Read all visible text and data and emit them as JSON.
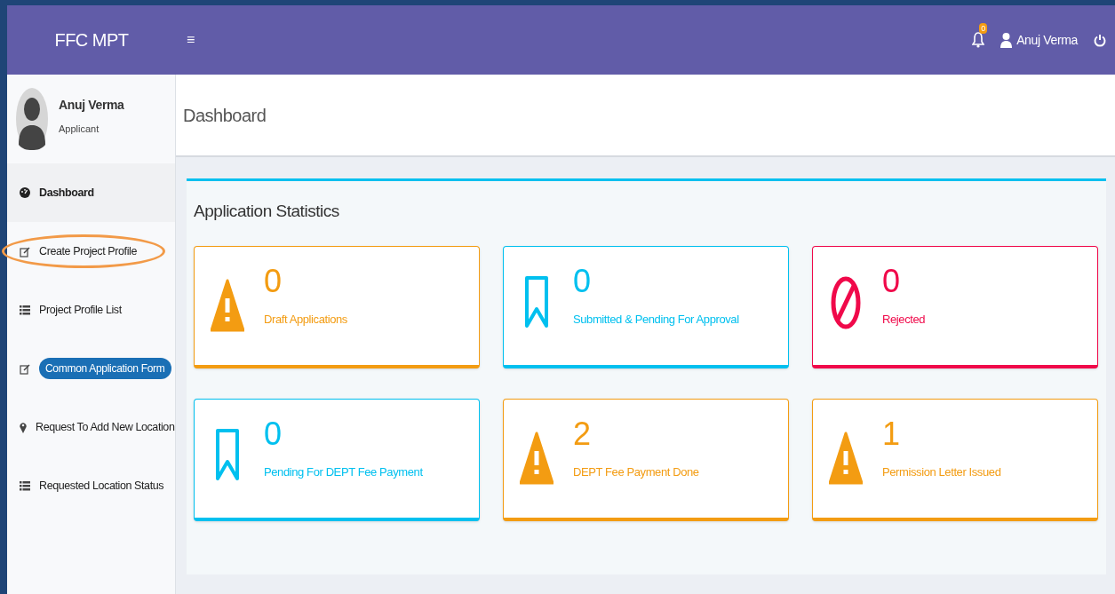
{
  "header": {
    "brand": "FFC MPT",
    "menu_glyph": "≡",
    "notification_count": "0",
    "user_name": "Anuj Verma"
  },
  "sidebar": {
    "user": {
      "name": "Anuj Verma",
      "role": "Applicant"
    },
    "items": [
      {
        "label": "Dashboard",
        "kind": "link",
        "selected": true,
        "highlighted": false
      },
      {
        "label": "Create Project Profile",
        "kind": "link",
        "selected": false,
        "highlighted": true
      },
      {
        "label": "Project Profile List",
        "kind": "link",
        "selected": false,
        "highlighted": false
      },
      {
        "label": "Common Application Form",
        "kind": "pill",
        "selected": false,
        "highlighted": false
      },
      {
        "label": "Request To Add New Location",
        "kind": "link",
        "selected": false,
        "highlighted": false
      },
      {
        "label": "Requested Location Status",
        "kind": "link",
        "selected": false,
        "highlighted": false
      }
    ]
  },
  "page_title": "Dashboard",
  "panel": {
    "title": "Application Statistics",
    "cards": [
      {
        "count": "0",
        "label": "Draft Applications",
        "kind": "warning",
        "color": "#f39c12"
      },
      {
        "count": "0",
        "label": "Submitted & Pending For Approval",
        "kind": "bookmark",
        "color": "#00c0ef"
      },
      {
        "count": "0",
        "label": "Rejected",
        "kind": "ban",
        "color": "#f0094a"
      },
      {
        "count": "0",
        "label": "Pending For DEPT Fee Payment",
        "kind": "bookmark",
        "color": "#00c0ef"
      },
      {
        "count": "2",
        "label": "DEPT Fee Payment Done",
        "kind": "warning",
        "color": "#f39c12"
      },
      {
        "count": "1",
        "label": "Permission Letter Issued",
        "kind": "warning",
        "color": "#f39c12"
      }
    ]
  }
}
